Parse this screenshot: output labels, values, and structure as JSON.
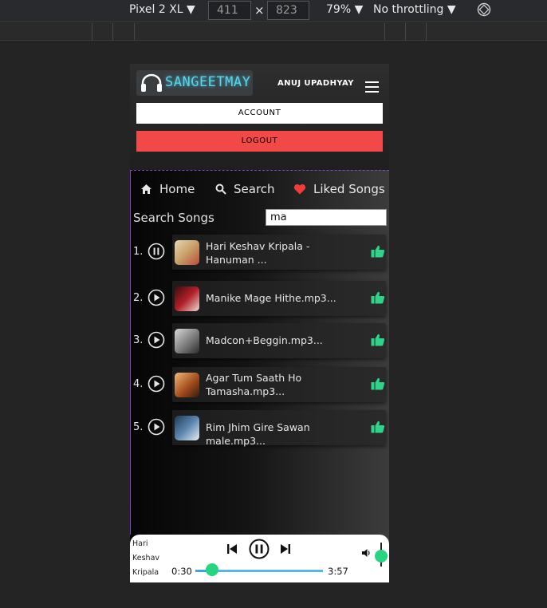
{
  "devtools": {
    "device": "Pixel 2 XL ▼",
    "width": "411",
    "times": "×",
    "height": "823",
    "zoom": "79% ▼",
    "throttle": "No throttling ▼"
  },
  "header": {
    "logo_text": "SANGEETMAY",
    "username": "ANUJ UPADHYAY",
    "account_label": "ACCOUNT",
    "logout_label": "LOGOUT",
    "logout_color": "#f34848"
  },
  "nav": {
    "home": "Home",
    "search": "Search",
    "liked": "Liked Songs"
  },
  "search": {
    "label": "Search Songs",
    "value": "ma"
  },
  "songs": [
    {
      "num": "1.",
      "title": "Hari Keshav Kripala - Hanuman ...",
      "state": "pause-icon"
    },
    {
      "num": "2.",
      "title": "Manike Mage Hithe.mp3...",
      "state": "play-icon"
    },
    {
      "num": "3.",
      "title": "Madcon+Beggin.mp3...",
      "state": "play-icon"
    },
    {
      "num": "4.",
      "title": "Agar Tum Saath Ho Tamasha.mp3...",
      "state": "play-icon"
    },
    {
      "num": "5.",
      "title": "Rim Jhim Gire Sawan male.mp3...",
      "state": "play-icon"
    }
  ],
  "player": {
    "now_playing": "Hari Keshav Kripala",
    "current_time": "0:30",
    "total_time": "3:57",
    "progress_fraction": 0.13,
    "accent_color": "#27d47f"
  }
}
